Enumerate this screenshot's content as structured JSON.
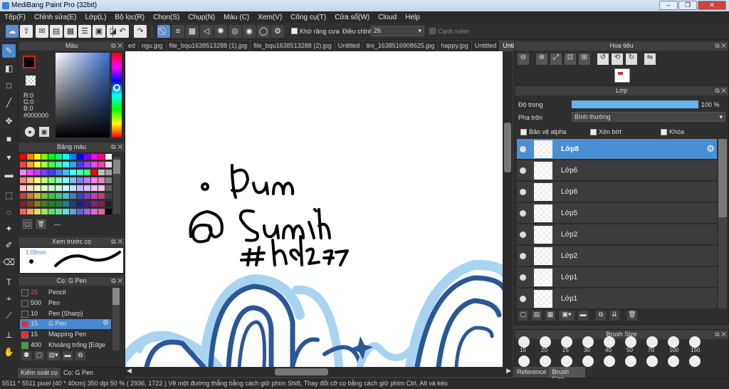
{
  "window": {
    "title": "MediBang Paint Pro (32bit)"
  },
  "menu": [
    "Tệp(F)",
    "Chỉnh sửa(E)",
    "Lớp(L)",
    "Bộ lọc(R)",
    "Chọn(S)",
    "Chụp(N)",
    "Màu (C)",
    "Xem(V)",
    "Công cụ(T)",
    "Cửa sổ(W)",
    "Cloud",
    "Help"
  ],
  "toolbar": {
    "antialias_label": "Khử răng cưa",
    "adjust_label": "Điều chỉnh",
    "adjust_value": "26",
    "edge_label": "Cạnh mềm"
  },
  "tabs": [
    "ed",
    "ngu.jpg",
    "file_bqu1638513288 (1).jpg",
    "file_bqu1638513288 (2).jpg",
    "Untitled",
    "tini_1638516908625.jpg",
    "happy.jpg",
    "Untitled",
    "Untitled"
  ],
  "color_panel": {
    "title": "Màu",
    "r": "R:0",
    "g": "G:0",
    "b": "B:0",
    "hex": "#000000"
  },
  "palette_panel": {
    "title": "Bảng màu",
    "footer": "---"
  },
  "preview_panel": {
    "title": "Xem trước cọ",
    "size": "1.09mm"
  },
  "brush_panel": {
    "title": "Cọ: G Pen",
    "items": [
      {
        "size": "25",
        "name": "Pencil"
      },
      {
        "size": "500",
        "name": "Pen"
      },
      {
        "size": "10",
        "name": "Pen (Sharp)"
      },
      {
        "size": "15",
        "name": "G Pen"
      },
      {
        "size": "15",
        "name": "Mapping Pen"
      },
      {
        "size": "400",
        "name": "Khoảng trống [Edge"
      }
    ]
  },
  "bottom_tabs": [
    "Kiểm soát cọ",
    "Cọ: G Pen"
  ],
  "navigator": {
    "title": "Hoa tiêu"
  },
  "layer_panel": {
    "title": "Lớp",
    "opacity_label": "Độ trong",
    "opacity_value": "100 %",
    "opacity_fraction": 1.0,
    "blend_label": "Pha trộn",
    "blend_value": "Bình thường",
    "protect_alpha": "Bảo vệ alpha",
    "clipping": "Xén bớt",
    "lock": "Khóa",
    "layers": [
      "Lớp8",
      "Lớp6",
      "Lớp6",
      "Lớp5",
      "Lớp2",
      "Lớp2",
      "Lớp1",
      "Lớp1"
    ]
  },
  "brush_size_panel": {
    "title": "Brush Size",
    "sizes": [
      "15",
      "20",
      "25",
      "30",
      "40",
      "50",
      "70",
      "100",
      "150"
    ]
  },
  "right_bottom_tabs": [
    "Reference",
    "Brush Size"
  ],
  "status": "5511 * 5511 pixel  (40 * 40cm)  350 dpi  50 %  ( 2936, 1722 )  Vẽ một đường thẳng bằng cách giữ phím Shift, Thay đổi cỡ cọ bằng cách giữ phím Ctrl, Alt và kéo",
  "colors": {
    "accent": "#4a8fd4",
    "foreground": "#000000",
    "brush_red": "#e03030",
    "ink_dark": "#2a5797",
    "ink_light": "#a9d4f0"
  }
}
